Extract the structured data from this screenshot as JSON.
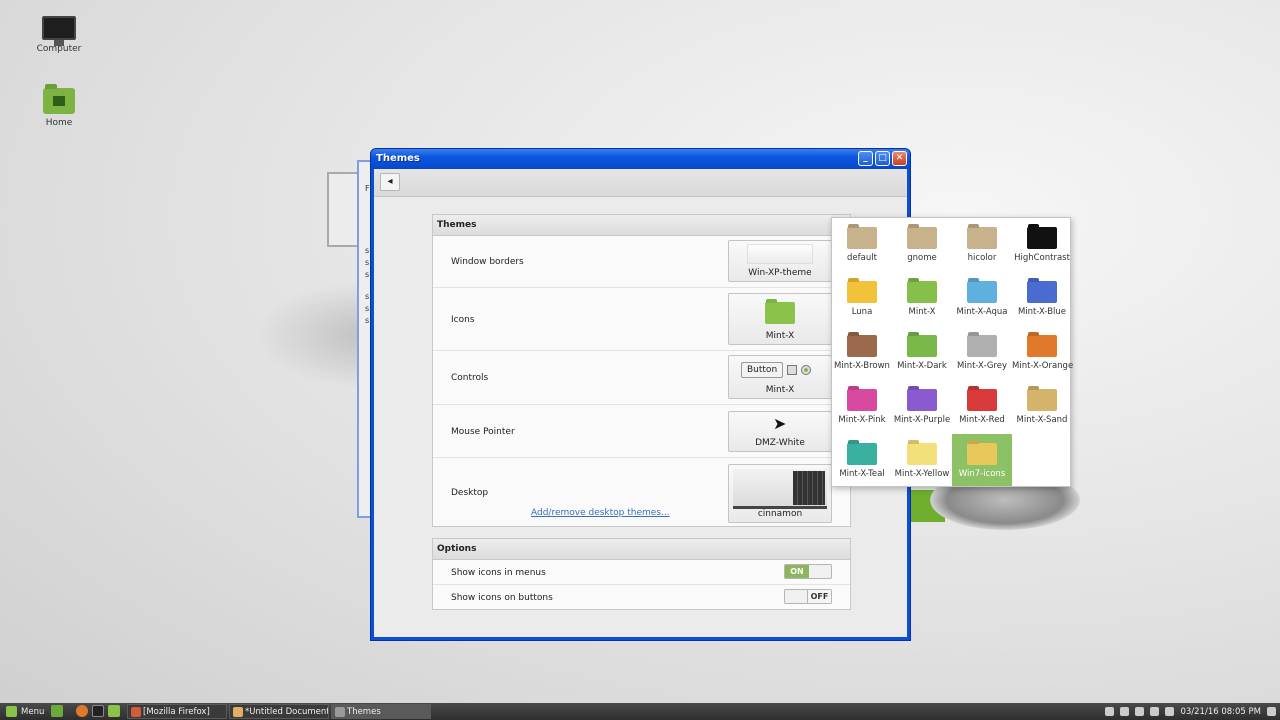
{
  "desktop": {
    "icons": [
      {
        "label": "Computer"
      },
      {
        "label": "Home"
      }
    ]
  },
  "background_window": {
    "lines": [
      "F",
      "s",
      "s",
      "s",
      "s",
      "s",
      "s"
    ]
  },
  "window": {
    "title": "Themes",
    "buttons": {
      "minimize": "_",
      "maximize": "□",
      "close": "✕"
    },
    "back_label": "◂",
    "themes_section": {
      "header": "Themes",
      "rows": [
        {
          "label": "Window borders",
          "value": "Win-XP-theme"
        },
        {
          "label": "Icons",
          "value": "Mint-X"
        },
        {
          "label": "Controls",
          "value": "Mint-X",
          "preview_button": "Button"
        },
        {
          "label": "Mouse Pointer",
          "value": "DMZ-White"
        },
        {
          "label": "Desktop",
          "value": "cinnamon",
          "link": "Add/remove desktop themes..."
        }
      ]
    },
    "options_section": {
      "header": "Options",
      "rows": [
        {
          "label": "Show icons in menus",
          "state": "ON"
        },
        {
          "label": "Show icons on buttons",
          "state": "OFF"
        }
      ]
    }
  },
  "icon_theme_popup": {
    "options": [
      {
        "name": "default",
        "color": "#c8b28c"
      },
      {
        "name": "gnome",
        "color": "#c8b28c"
      },
      {
        "name": "hicolor",
        "color": "#c8b28c"
      },
      {
        "name": "HighContrast",
        "color": "#111111"
      },
      {
        "name": "Luna",
        "color": "#f2c23a"
      },
      {
        "name": "Mint-X",
        "color": "#86bf4a"
      },
      {
        "name": "Mint-X-Aqua",
        "color": "#5fb0dc"
      },
      {
        "name": "Mint-X-Blue",
        "color": "#4a6cd0"
      },
      {
        "name": "Mint-X-Brown",
        "color": "#9a6a4a"
      },
      {
        "name": "Mint-X-Dark",
        "color": "#7ab84a"
      },
      {
        "name": "Mint-X-Grey",
        "color": "#b0b0b0"
      },
      {
        "name": "Mint-X-Orange",
        "color": "#e07a2a"
      },
      {
        "name": "Mint-X-Pink",
        "color": "#d84aa0"
      },
      {
        "name": "Mint-X-Purple",
        "color": "#8a5ad0"
      },
      {
        "name": "Mint-X-Red",
        "color": "#d83a3a"
      },
      {
        "name": "Mint-X-Sand",
        "color": "#d4b46a"
      },
      {
        "name": "Mint-X-Teal",
        "color": "#3ab0a0"
      },
      {
        "name": "Mint-X-Yellow",
        "color": "#f2e07a"
      },
      {
        "name": "Win7-icons",
        "color": "#e8c85a",
        "selected": true
      }
    ]
  },
  "taskbar": {
    "menu_label": "Menu",
    "tasks": [
      {
        "label": "[Mozilla Firefox]",
        "icon_color": "#d35a3a"
      },
      {
        "label": "*Untitled Document...",
        "icon_color": "#e0b060"
      },
      {
        "label": "Themes",
        "icon_color": "#9a9a9a",
        "active": true
      }
    ],
    "clock": "03/21/16 08:05 PM"
  }
}
